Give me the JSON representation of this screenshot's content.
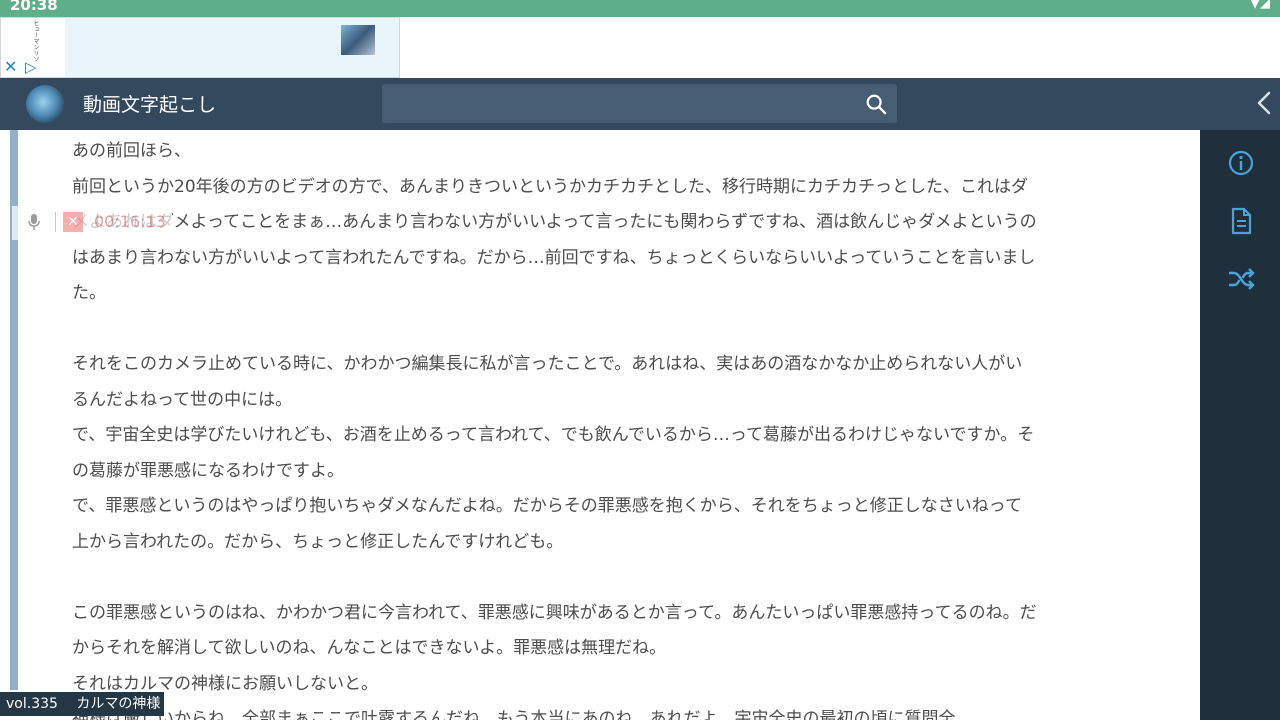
{
  "status_bar": {
    "time": "20:38",
    "icons": "▼◢"
  },
  "ad": {
    "logo_text": "ヒューマンリソ",
    "close": "✕",
    "play": "▷"
  },
  "header": {
    "title": "動画文字起こし",
    "search_placeholder": ""
  },
  "sidebar": {
    "items": [
      "info-icon",
      "document-icon",
      "shuffle-icon"
    ]
  },
  "overlay": {
    "close": "✕",
    "timestamp": "00:16:13"
  },
  "transcript": [
    "あの前回ほら、",
    "前回というか20年後の方のビデオの方で、あんまりきついというかカチカチとした、移行時期にカチカチっとした、これはダ",
    "メよあれはダメよってことをまぁ…あんまり言わない方がいいよって言ったにも関わらずですね、酒は飲んじゃダメよというの",
    "はあまり言わない方がいいよって言われたんですね。だから…前回ですね、ちょっとくらいならいいよっていうことを言いまし",
    "た。",
    "",
    "それをこのカメラ止めている時に、かわかつ編集長に私が言ったことで。あれはね、実はあの酒なかなか止められない人がい",
    "るんだよねって世の中には。",
    "で、宇宙全史は学びたいけれども、お酒を止めるって言われて、でも飲んでいるから…って葛藤が出るわけじゃないですか。そ",
    "の葛藤が罪悪感になるわけですよ。",
    "で、罪悪感というのはやっぱり抱いちゃダメなんだよね。だからその罪悪感を抱くから、それをちょっと修正しなさいねって",
    "上から言われたの。だから、ちょっと修正したんですけれども。",
    "",
    "この罪悪感というのはね、かわかつ君に今言われて、罪悪感に興味があるとか言って。あんたいっぱい罪悪感持ってるのね。だ",
    "からそれを解消して欲しいのね、んなことはできないよ。罪悪感は無理だね。",
    "それはカルマの神様にお願いしないと。",
    "神様は厳しいからね。全部まぁここで吐露するんだね。もう本当にあのね、あれだよ、宇宙全史の最初の頃に質問全"
  ],
  "bottom_label": {
    "volume": "vol.335",
    "title": "カルマの神様"
  }
}
